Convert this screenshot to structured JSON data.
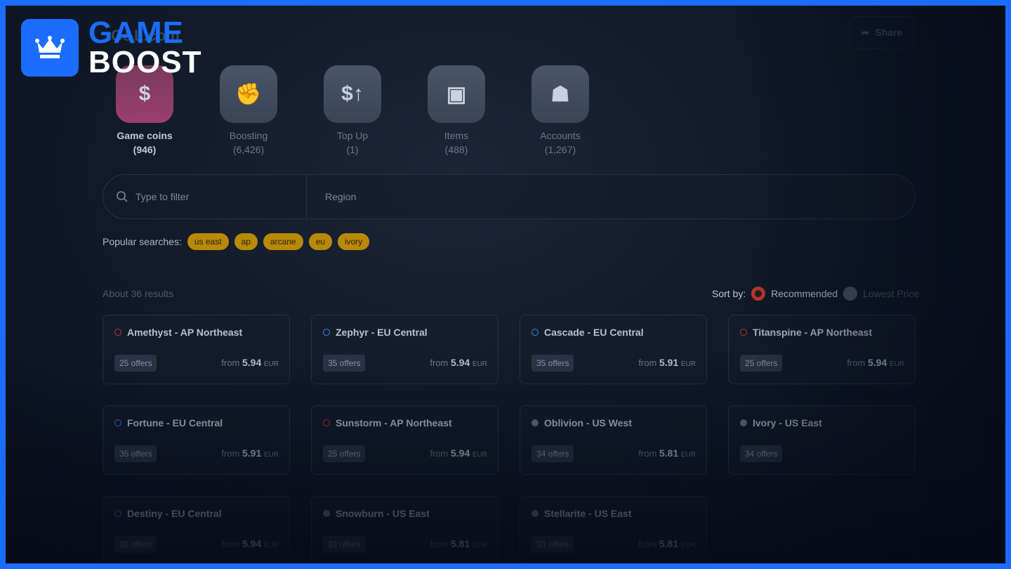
{
  "site_title": "G&L.com",
  "share_label": "Share",
  "logo": {
    "line1": "GAME",
    "line2": "BOOST"
  },
  "categories": [
    {
      "label": "Game coins",
      "count": "(946)"
    },
    {
      "label": "Boosting",
      "count": "(6,426)"
    },
    {
      "label": "Top Up",
      "count": "(1)"
    },
    {
      "label": "Items",
      "count": "(488)"
    },
    {
      "label": "Accounts",
      "count": "(1,267)"
    }
  ],
  "search": {
    "placeholder": "Type to filter",
    "region": "Region"
  },
  "popular": {
    "label": "Popular searches:",
    "chips": [
      "us east",
      "ap",
      "arcane",
      "eu",
      "ivory"
    ]
  },
  "results": "About 36 results",
  "sort": {
    "label": "Sort by:",
    "options": [
      "Recommended",
      "Lowest Price"
    ],
    "selected": "Recommended"
  },
  "colors": {
    "accent": "#1a6dff",
    "chip": "#b98a0a",
    "selected_radio": "#c0392b"
  },
  "cards": [
    {
      "name": "Amethyst - AP Northeast",
      "region": "ap",
      "offers": "25 offers",
      "from": "from",
      "price": "5.94",
      "cur": "EUR"
    },
    {
      "name": "Zephyr - EU Central",
      "region": "eu",
      "offers": "35 offers",
      "from": "from",
      "price": "5.94",
      "cur": "EUR"
    },
    {
      "name": "Cascade - EU Central",
      "region": "eu",
      "offers": "35 offers",
      "from": "from",
      "price": "5.91",
      "cur": "EUR"
    },
    {
      "name": "Titanspine - AP Northeast",
      "region": "ap",
      "offers": "25 offers",
      "from": "from",
      "price": "5.94",
      "cur": "EUR"
    },
    {
      "name": "Fortune - EU Central",
      "region": "eu",
      "offers": "35 offers",
      "from": "from",
      "price": "5.91",
      "cur": "EUR"
    },
    {
      "name": "Sunstorm - AP Northeast",
      "region": "ap",
      "offers": "25 offers",
      "from": "from",
      "price": "5.94",
      "cur": "EUR"
    },
    {
      "name": "Oblivion - US West",
      "region": "us",
      "offers": "34 offers",
      "from": "from",
      "price": "5.81",
      "cur": "EUR"
    },
    {
      "name": "Ivory - US East",
      "region": "us",
      "offers": "34 offers"
    },
    {
      "name": "Destiny - EU Central",
      "region": "eu",
      "offers": "35 offers",
      "from": "from",
      "price": "5.94",
      "cur": "EUR"
    },
    {
      "name": "Snowburn - US East",
      "region": "us",
      "offers": "33 offers",
      "from": "from",
      "price": "5.81",
      "cur": "EUR"
    },
    {
      "name": "Stellarite - US East",
      "region": "us",
      "offers": "33 offers",
      "from": "from",
      "price": "5.81",
      "cur": "EUR"
    }
  ]
}
